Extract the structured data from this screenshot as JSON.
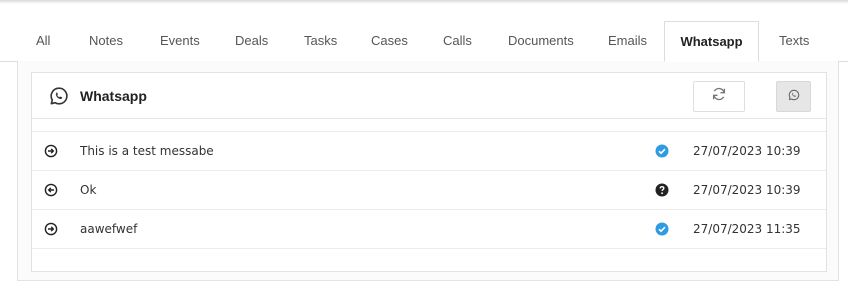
{
  "tabs": [
    {
      "label": "All"
    },
    {
      "label": "Notes"
    },
    {
      "label": "Events"
    },
    {
      "label": "Deals"
    },
    {
      "label": "Tasks"
    },
    {
      "label": "Cases"
    },
    {
      "label": "Calls"
    },
    {
      "label": "Documents"
    },
    {
      "label": "Emails"
    },
    {
      "label": "Whatsapp",
      "active": true
    },
    {
      "label": "Texts"
    }
  ],
  "panel": {
    "title": "Whatsapp",
    "icon": "whatsapp-icon",
    "refresh_icon": "refresh-icon",
    "whatsapp_button_icon": "whatsapp-icon"
  },
  "messages": [
    {
      "direction": "outgoing",
      "text": "This is a test messabe",
      "status": "delivered",
      "timestamp": "27/07/2023 10:39"
    },
    {
      "direction": "incoming",
      "text": "Ok",
      "status": "unknown",
      "timestamp": "27/07/2023 10:39"
    },
    {
      "direction": "outgoing",
      "text": "aawefwef",
      "status": "delivered",
      "timestamp": "27/07/2023 11:35"
    }
  ],
  "colors": {
    "delivered": "#2f9be3",
    "unknown": "#222222"
  }
}
